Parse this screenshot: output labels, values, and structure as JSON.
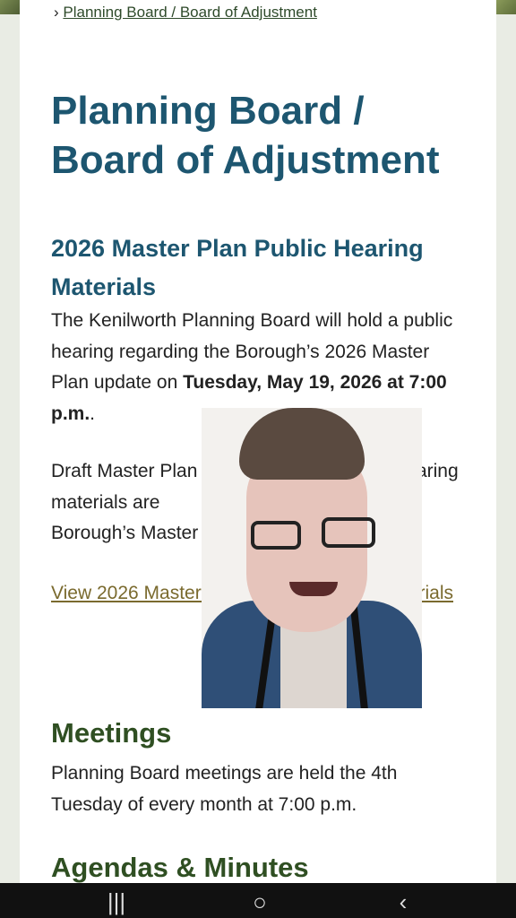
{
  "breadcrumb": {
    "separator": "›",
    "link": "Planning Board / Board of Adjustment"
  },
  "page_title_line1": "Planning Board /",
  "page_title_line2": "Board of Adjustment",
  "section1": {
    "heading": "2026 Master Plan Public Hearing Materials",
    "para1_part1": "The Kenilworth Planning Board will hold a public hearing regarding the Borough’s 2026 Master Plan update on ",
    "para1_bold": "Tuesday, May 19, 2026 at 7:00 p.m.",
    "para1_end": ".",
    "para2": "Draft Master Plan ele",
    "para2b": "blic hearing materials are",
    "para2c": "eview on the Borough’s Master",
    "link": "View 2026 Master Plan Public Hearing Materials"
  },
  "meetings": {
    "heading": "Meetings",
    "text": "Planning Board meetings are held the 4th Tuesday of every month at 7:00 p.m."
  },
  "agendas": {
    "heading": "Agendas & Minutes"
  },
  "nav": {
    "recents": "|||",
    "home": "○",
    "back": "‹"
  }
}
